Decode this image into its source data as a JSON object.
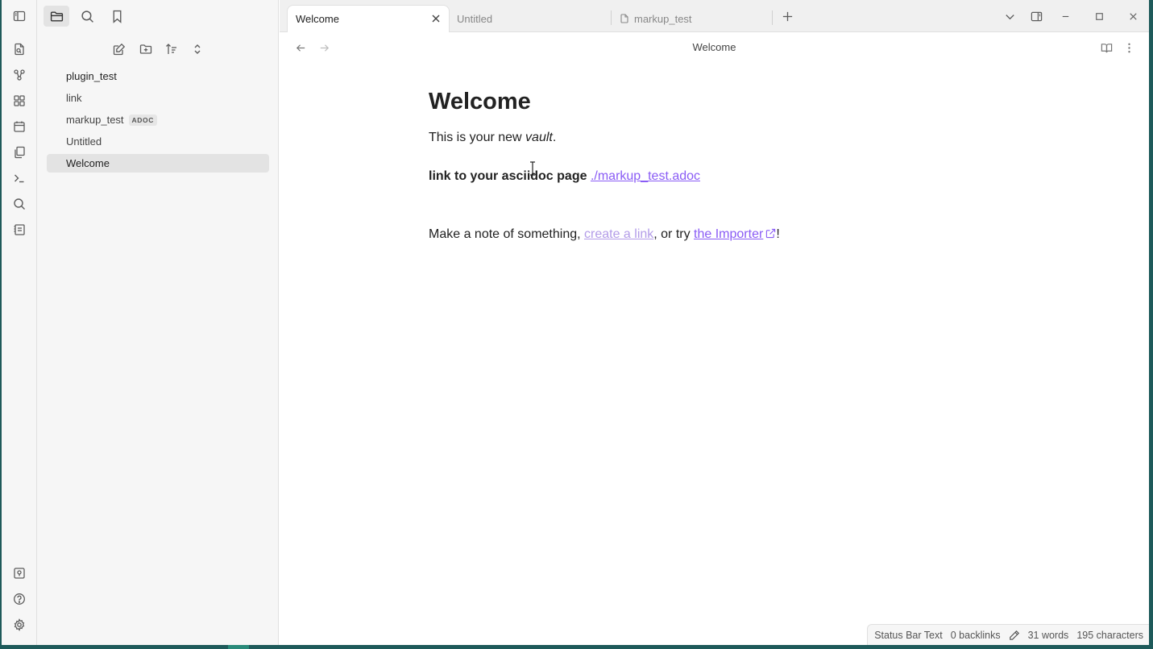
{
  "ribbon": {
    "items": [
      {
        "name": "open-quick-switcher-icon"
      },
      {
        "name": "graph-view-icon"
      },
      {
        "name": "canvas-icon"
      },
      {
        "name": "daily-note-icon"
      },
      {
        "name": "templates-icon"
      },
      {
        "name": "command-palette-icon"
      },
      {
        "name": "search-icon"
      },
      {
        "name": "slides-icon"
      }
    ],
    "bottom": [
      {
        "name": "vault-switcher-icon"
      },
      {
        "name": "help-icon"
      },
      {
        "name": "settings-icon"
      }
    ]
  },
  "sidebar": {
    "tree": [
      {
        "label": "plugin_test",
        "type": "folder"
      },
      {
        "label": "link",
        "type": "file"
      },
      {
        "label": "markup_test",
        "type": "file",
        "badge": "ADOC"
      },
      {
        "label": "Untitled",
        "type": "file"
      },
      {
        "label": "Welcome",
        "type": "file",
        "active": true
      }
    ]
  },
  "tabs": [
    {
      "label": "Welcome",
      "active": true
    },
    {
      "label": "Untitled",
      "active": false
    },
    {
      "label": "markup_test",
      "active": false
    }
  ],
  "view": {
    "title": "Welcome"
  },
  "document": {
    "heading": "Welcome",
    "p1_prefix": "This is your new ",
    "p1_em": "vault",
    "p1_suffix": ".",
    "p2_bold": "link to your asciidoc page",
    "p2_link": "./markup_test.adoc",
    "p3_prefix": "Make a note of something, ",
    "p3_link1": "create a link",
    "p3_mid": ", or try ",
    "p3_link2": "the Importer",
    "p3_suffix": "!"
  },
  "statusbar": {
    "text": "Status Bar Text",
    "backlinks": "0 backlinks",
    "words": "31 words",
    "characters": "195 characters"
  },
  "colors": {
    "accent": "#8a5cf5",
    "unresolved_link": "#b39ce8",
    "desktop": "#1e5a5a"
  }
}
